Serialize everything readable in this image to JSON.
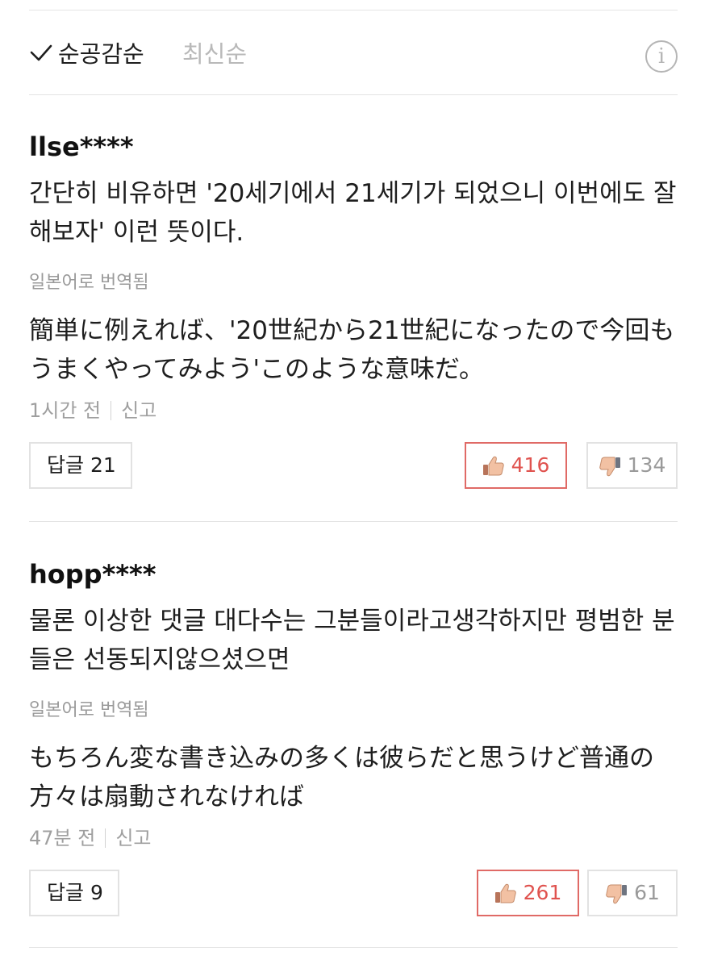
{
  "sort": {
    "active_label": "순공감순",
    "inactive_label": "최신순",
    "info_symbol": "i"
  },
  "comments": [
    {
      "author": "llse****",
      "text_ko": "간단히 비유하면 '20세기에서 21세기가 되었으니 이번에도 잘해보자' 이런 뜻이다.",
      "translated_label": "일본어로 번역됨",
      "text_ja": "簡単に例えれば、'20世紀から21世紀になったので今回もうまくやってみよう'このような意味だ。",
      "time": "1시간 전",
      "report_label": "신고",
      "reply_label": "답글 21",
      "like_count": "416",
      "dislike_count": "134"
    },
    {
      "author": "hopp****",
      "text_ko": "물론 이상한 댓글 대다수는 그분들이라고생각하지만 평범한 분들은 선동되지않으셨으면",
      "translated_label": "일본어로 번역됨",
      "text_ja": "もちろん変な書き込みの多くは彼らだと思うけど普通の方々は扇動されなければ",
      "time": "47분 전",
      "report_label": "신고",
      "reply_label": "답글 9",
      "like_count": "261",
      "dislike_count": "61"
    }
  ],
  "colors": {
    "like_accent": "#e0534f",
    "muted_text": "#9a9a9a",
    "divider": "#e4e4e4"
  },
  "icons": {
    "sort_check": "check-icon",
    "info": "info-icon",
    "like": "thumbs-up-icon",
    "dislike": "thumbs-down-icon"
  }
}
